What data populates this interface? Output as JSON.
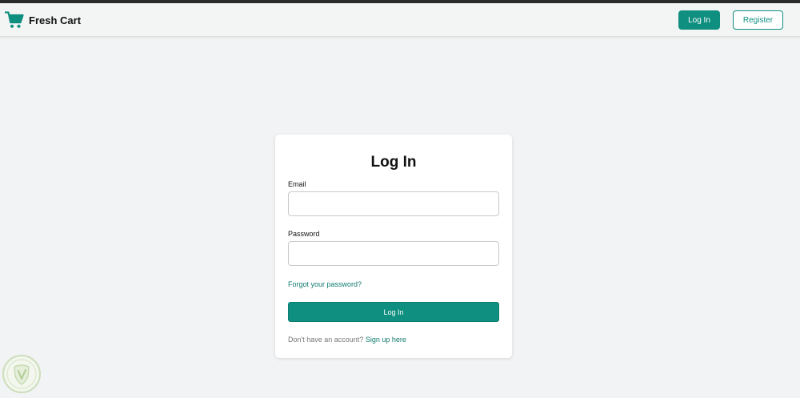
{
  "brand": {
    "name": "Fresh Cart",
    "icon": "shopping-cart-icon",
    "color": "#0f8f80"
  },
  "nav": {
    "login_label": "Log In",
    "register_label": "Register"
  },
  "login_card": {
    "title": "Log In",
    "email_label": "Email",
    "email_value": "",
    "password_label": "Password",
    "password_value": "",
    "forgot_label": "Forgot your password?",
    "submit_label": "Log In",
    "signup_prompt": "Don't have an account?",
    "signup_link": "Sign up here"
  },
  "colors": {
    "accent": "#0f8f80",
    "page_background": "#f2f3f5"
  }
}
